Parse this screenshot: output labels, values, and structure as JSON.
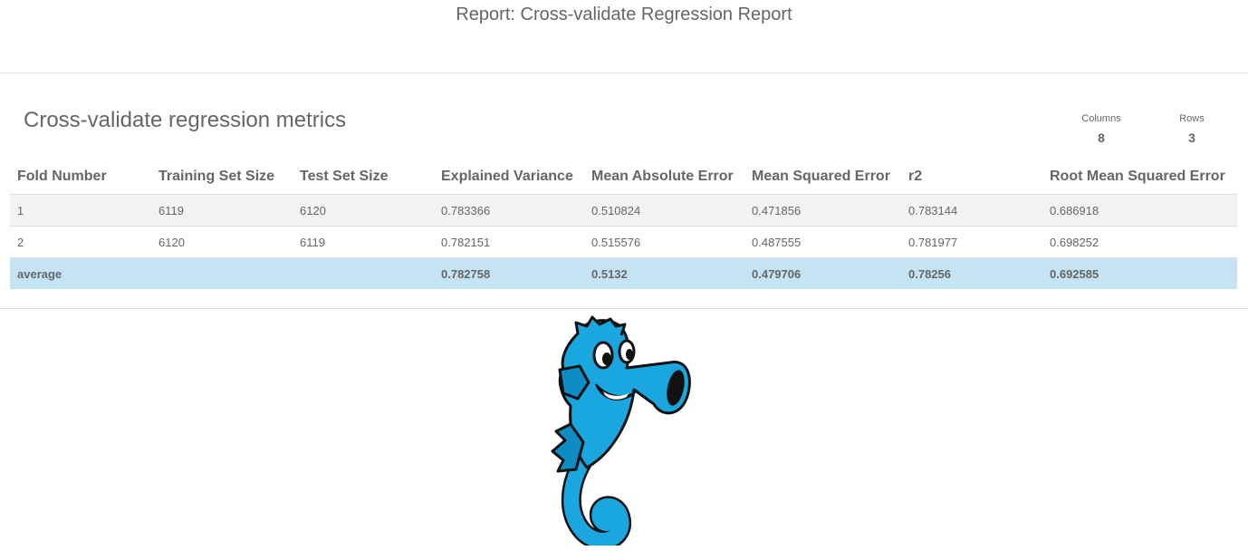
{
  "header": {
    "report_title": "Report: Cross-validate Regression Report"
  },
  "section": {
    "title": "Cross-validate regression metrics",
    "stats": {
      "columns_label": "Columns",
      "columns_value": "8",
      "rows_label": "Rows",
      "rows_value": "3"
    }
  },
  "table": {
    "headers": [
      "Fold Number",
      "Training Set Size",
      "Test Set Size",
      "Explained Variance",
      "Mean Absolute Error",
      "Mean Squared Error",
      "r2",
      "Root Mean Squared Error"
    ],
    "rows": [
      [
        "1",
        "6119",
        "6120",
        "0.783366",
        "0.510824",
        "0.471856",
        "0.783144",
        "0.686918"
      ],
      [
        "2",
        "6120",
        "6119",
        "0.782151",
        "0.515576",
        "0.487555",
        "0.781977",
        "0.698252"
      ],
      [
        "average",
        "",
        "",
        "0.782758",
        "0.5132",
        "0.479706",
        "0.78256",
        "0.692585"
      ]
    ]
  },
  "colors": {
    "average_row_bg": "#c4e3f3",
    "odd_row_bg": "#f3f3f3",
    "mascot_body": "#1aa7e0",
    "mascot_outline": "#111111"
  },
  "mascot": {
    "icon": "seahorse-mascot-icon"
  }
}
